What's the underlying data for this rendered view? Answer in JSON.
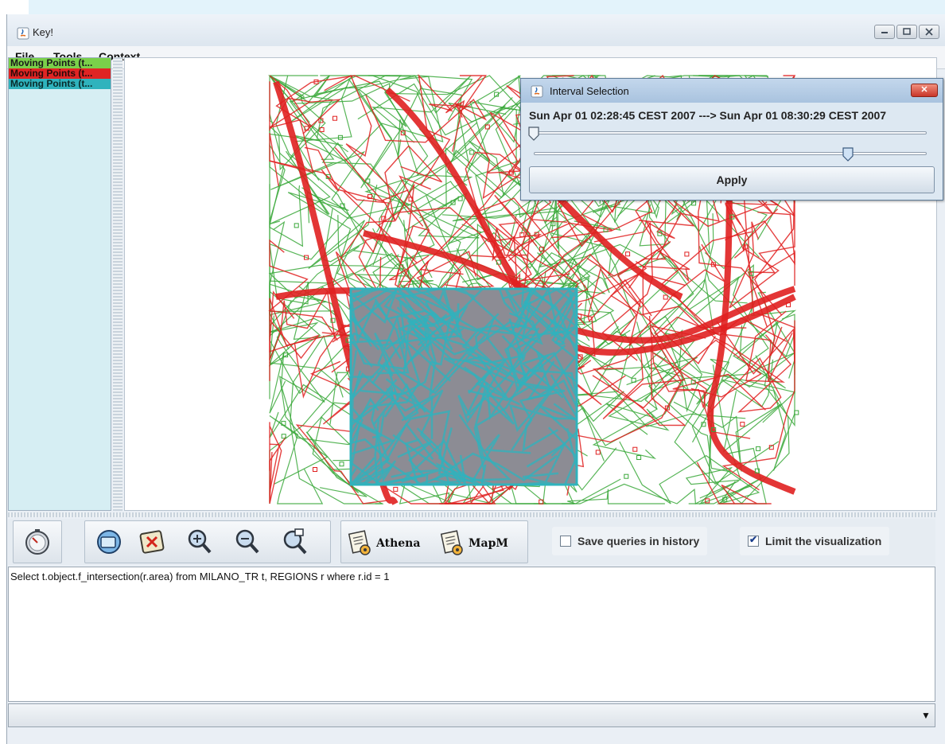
{
  "window": {
    "title": "Key!"
  },
  "menu": [
    "File",
    "Tools",
    "Context"
  ],
  "layers": [
    {
      "label": "Moving Points (t...",
      "background": "#7ad04a"
    },
    {
      "label": "Moving Points (t...",
      "background": "#e02424"
    },
    {
      "label": "Moving Points (t...",
      "background": "#2fb3bd"
    }
  ],
  "toolbar": {
    "athena_label": "Athena",
    "mapm_label": "MapM",
    "save_queries_label": "Save queries in history",
    "save_queries_checked": false,
    "limit_visualization_label": "Limit the visualization",
    "limit_visualization_checked": true
  },
  "query": {
    "text": "Select t.object.f_intersection(r.area) from MILANO_TR t, REGIONS r where r.id = 1"
  },
  "interval_dialog": {
    "title": "Interval Selection",
    "range_text": "Sun Apr 01 02:28:45 CEST 2007 ---> Sun Apr 01 08:30:29 CEST 2007",
    "start_fraction": 0.0,
    "end_fraction": 0.8,
    "apply_label": "Apply"
  },
  "colors": {
    "trajectory_green": "#3aa83a",
    "trajectory_red": "#e02020",
    "region_gray": "#8c8c94",
    "region_cyan": "#2fb3bd"
  }
}
